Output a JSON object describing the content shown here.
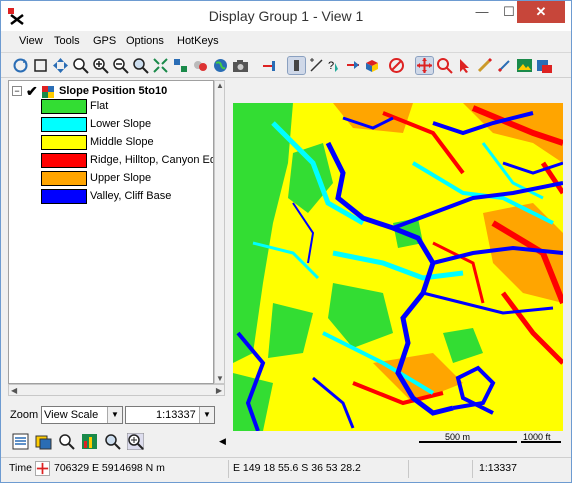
{
  "window": {
    "title": "Display Group 1 - View 1",
    "minimize": "—",
    "maximize": "☐",
    "close": "✕"
  },
  "menubar": {
    "items": [
      "View",
      "Tools",
      "GPS",
      "Options",
      "HotKeys"
    ]
  },
  "toolbar": {
    "icons": [
      "redraw-icon",
      "full-view-icon",
      "pan-icon",
      "zoom-box-icon",
      "zoom-in-icon",
      "zoom-out-icon",
      "zoom-selected-icon",
      "fit-group-icon",
      "layer-controls-icon",
      "layout-icon",
      "world-icon",
      "camera-icon",
      "add-layer-icon",
      "select-tool-icon",
      "measure-icon",
      "help-pointer-icon",
      "cursor-icon",
      "3d-icon",
      "stop-icon",
      "move-icon",
      "zoom-target-icon",
      "select-arrow-icon",
      "pencil-icon",
      "pen-icon",
      "image-icon",
      "tools-icon"
    ]
  },
  "legend": {
    "expand": "−",
    "check": "✔",
    "layer_name": "Slope Position 5to10",
    "items": [
      {
        "label": "Flat",
        "color": "#33dd33"
      },
      {
        "label": "Lower Slope",
        "color": "#00ffff"
      },
      {
        "label": "Middle Slope",
        "color": "#ffff00"
      },
      {
        "label": "Ridge, Hilltop, Canyon Ed",
        "color": "#ff0000"
      },
      {
        "label": "Upper Slope",
        "color": "#ffa500"
      },
      {
        "label": "Valley, Cliff Base",
        "color": "#0000ff"
      }
    ]
  },
  "zoom": {
    "label": "Zoom",
    "mode": "View Scale",
    "scale": "1:13337"
  },
  "scalebars": {
    "metric": "500 m",
    "imperial": "1000 ft"
  },
  "status": {
    "time_label": "Time",
    "utm": "706329 E   5914698 N m",
    "latlon": "E 149 18 55.6   S 36 53 28.2",
    "scale": "1:13337"
  }
}
